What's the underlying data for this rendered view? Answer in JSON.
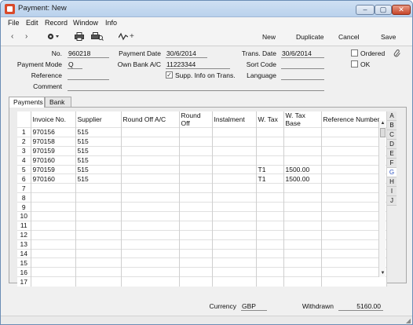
{
  "window": {
    "title": "Payment: New",
    "controls": {
      "minimize": "‒",
      "maximize": "▢",
      "close": "✕"
    }
  },
  "menu": [
    "File",
    "Edit",
    "Record",
    "Window",
    "Info"
  ],
  "toolbar": {
    "new": "New",
    "duplicate": "Duplicate",
    "cancel": "Cancel",
    "save": "Save",
    "back_arrow": "‹",
    "forward_arrow": "›",
    "activity_plus": "+"
  },
  "form": {
    "no_label": "No.",
    "no": "960218",
    "payment_mode_label": "Payment Mode",
    "payment_mode": "Q",
    "reference_label": "Reference",
    "reference": "",
    "comment_label": "Comment",
    "comment": "",
    "payment_date_label": "Payment Date",
    "payment_date": "30/6/2014",
    "own_bank_label": "Own Bank A/C",
    "own_bank": "11223344",
    "supp_info_label": "Supp. Info on Trans.",
    "supp_info_checked": "✓",
    "trans_date_label": "Trans. Date",
    "trans_date": "30/6/2014",
    "sort_code_label": "Sort Code",
    "sort_code": "",
    "language_label": "Language",
    "language": "",
    "ordered_label": "Ordered",
    "ok_label": "OK"
  },
  "tabs": [
    "Payments",
    "Bank"
  ],
  "grid": {
    "headers": [
      "",
      "Invoice No.",
      "Supplier",
      "Round Off A/C",
      "Round Off",
      "Instalment",
      "W. Tax",
      "W. Tax Base",
      "Reference Number"
    ],
    "rows": [
      [
        "1",
        "970156",
        "515",
        "",
        "",
        "",
        "",
        "",
        ""
      ],
      [
        "2",
        "970158",
        "515",
        "",
        "",
        "",
        "",
        "",
        ""
      ],
      [
        "3",
        "970159",
        "515",
        "",
        "",
        "",
        "",
        "",
        ""
      ],
      [
        "4",
        "970160",
        "515",
        "",
        "",
        "",
        "",
        "",
        ""
      ],
      [
        "5",
        "970159",
        "515",
        "",
        "",
        "",
        "T1",
        "1500.00",
        ""
      ],
      [
        "6",
        "970160",
        "515",
        "",
        "",
        "",
        "T1",
        "1500.00",
        ""
      ],
      [
        "7",
        "",
        "",
        "",
        "",
        "",
        "",
        "",
        ""
      ],
      [
        "8",
        "",
        "",
        "",
        "",
        "",
        "",
        "",
        ""
      ],
      [
        "9",
        "",
        "",
        "",
        "",
        "",
        "",
        "",
        ""
      ],
      [
        "10",
        "",
        "",
        "",
        "",
        "",
        "",
        "",
        ""
      ],
      [
        "11",
        "",
        "",
        "",
        "",
        "",
        "",
        "",
        ""
      ],
      [
        "12",
        "",
        "",
        "",
        "",
        "",
        "",
        "",
        ""
      ],
      [
        "13",
        "",
        "",
        "",
        "",
        "",
        "",
        "",
        ""
      ],
      [
        "14",
        "",
        "",
        "",
        "",
        "",
        "",
        "",
        ""
      ],
      [
        "15",
        "",
        "",
        "",
        "",
        "",
        "",
        "",
        ""
      ],
      [
        "16",
        "",
        "",
        "",
        "",
        "",
        "",
        "",
        ""
      ],
      [
        "17",
        "",
        "",
        "",
        "",
        "",
        "",
        "",
        ""
      ]
    ],
    "scroll_up": "▲",
    "scroll_down": "▼"
  },
  "letters": [
    "A",
    "B",
    "C",
    "D",
    "E",
    "F",
    "G",
    "H",
    "I",
    "J"
  ],
  "selected_letter": "G",
  "footer": {
    "currency_label": "Currency",
    "currency": "GBP",
    "withdrawn_label": "Withdrawn",
    "withdrawn": "5160.00"
  },
  "colors": {
    "accent": "#2f54c2",
    "title_bar": "#b9d1ec"
  }
}
